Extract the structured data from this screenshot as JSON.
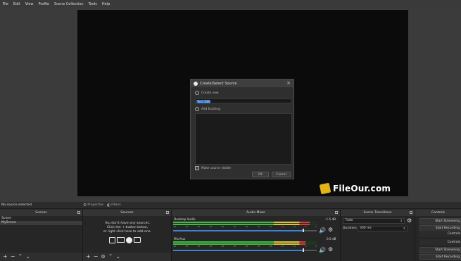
{
  "menu": [
    "File",
    "Edit",
    "View",
    "Profile",
    "Scene Collection",
    "Tools",
    "Help"
  ],
  "dialog": {
    "title": "Create/Select Source",
    "create_new_label": "Create new",
    "input_value": "Text (GDI+)",
    "add_existing_label": "Add Existing",
    "make_visible_label": "Make source visible",
    "ok_label": "OK",
    "cancel_label": "Cancel"
  },
  "watermark": {
    "text": "FileOur.com"
  },
  "props_bar": {
    "status": "No source selected",
    "properties_label": "Properties",
    "filters_label": "Filters"
  },
  "scenes": {
    "title": "Scenes",
    "items": [
      "Scene",
      "MyScene"
    ]
  },
  "sources": {
    "title": "Sources",
    "empty_line1": "You don't have any sources.",
    "empty_line2": "Click the + button below,",
    "empty_line3": "or right click here to add one."
  },
  "mixer": {
    "title": "Audio Mixer",
    "channels": [
      {
        "name": "Desktop Audio",
        "db": "-1.5 dB",
        "level": 0.95,
        "volume": 0.9
      },
      {
        "name": "Mic/Aux",
        "db": "0.0 dB",
        "level": 0.92,
        "volume": 0.9
      }
    ],
    "ticks": [
      "-60",
      "-55",
      "-50",
      "-45",
      "-40",
      "-35",
      "-30",
      "-25",
      "-20",
      "-15",
      "-10",
      "-5",
      "0"
    ]
  },
  "transitions": {
    "title": "Scene Transitions",
    "type": "Fade",
    "duration_label": "Duration",
    "duration_value": "300 ms"
  },
  "controls": {
    "title": "Controls",
    "buttons": [
      "Start Streaming",
      "Start Recording",
      "Controls",
      "Controls",
      "Start Streaming",
      "Start Recording"
    ]
  },
  "colors": {
    "accent": "#3a83d6",
    "meter_green": "#3fbf3f",
    "meter_yellow": "#d8c43a",
    "meter_red": "#d63b3b",
    "watermark_logo": "#e1b41a"
  }
}
